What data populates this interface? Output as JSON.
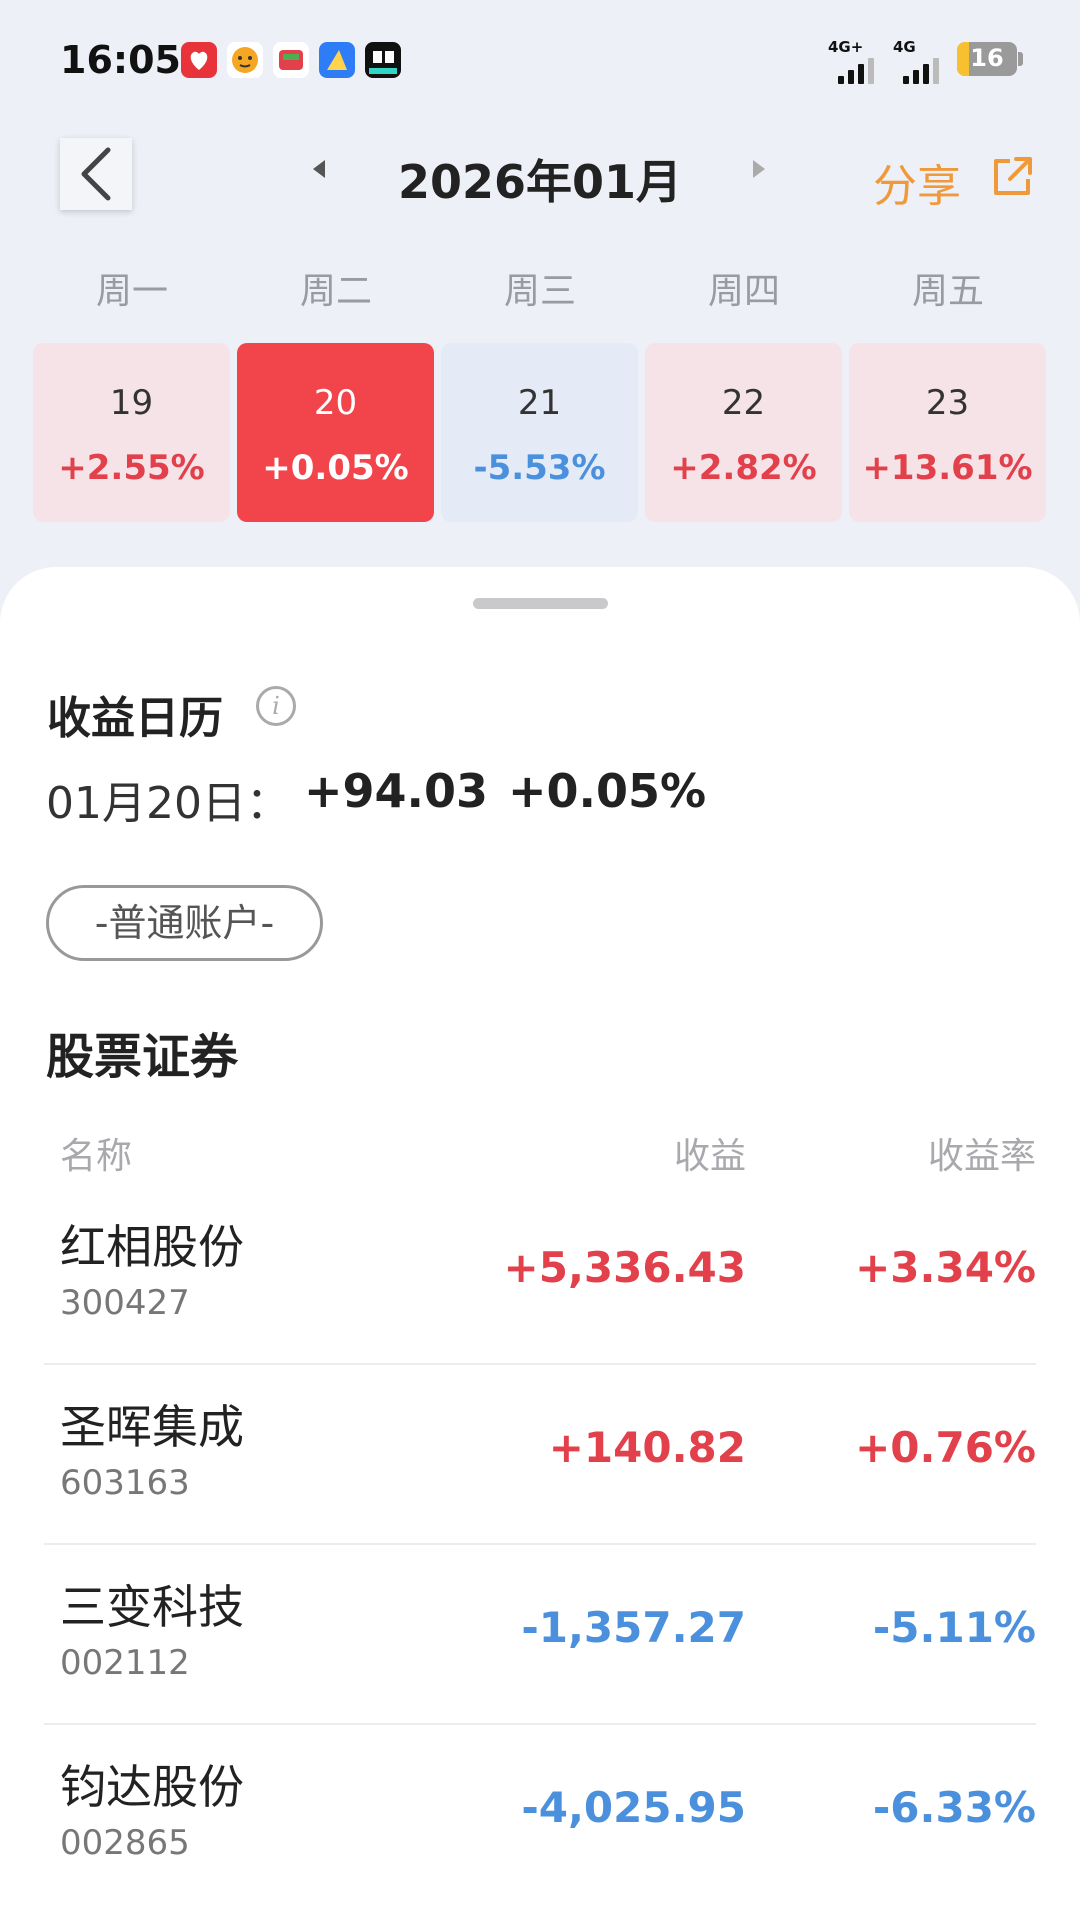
{
  "status_bar": {
    "time": "16:05",
    "network1": "4G+",
    "network2": "4G",
    "battery": "16",
    "app_icons": [
      "pinduoduo-icon",
      "tiger-app-icon",
      "jd-app-icon",
      "blue-app-icon",
      "dewu-app-icon"
    ]
  },
  "header": {
    "month": "2026年01月",
    "share_label": "分享"
  },
  "week": {
    "weekdays": [
      "周一",
      "周二",
      "周三",
      "周四",
      "周五"
    ],
    "days": [
      {
        "day": "19",
        "pct": "+2.55%",
        "state": "up"
      },
      {
        "day": "20",
        "pct": "+0.05%",
        "state": "selected"
      },
      {
        "day": "21",
        "pct": "-5.53%",
        "state": "down"
      },
      {
        "day": "22",
        "pct": "+2.82%",
        "state": "up"
      },
      {
        "day": "23",
        "pct": "+13.61%",
        "state": "up"
      }
    ]
  },
  "summary": {
    "title": "收益日历",
    "date_label": "01月20日：",
    "amount": "+94.03",
    "pct": "+0.05%"
  },
  "account": {
    "label": "-普通账户-"
  },
  "stocks": {
    "title": "股票证券",
    "columns": [
      "名称",
      "收益",
      "收益率"
    ],
    "rows": [
      {
        "name": "红相股份",
        "code": "300427",
        "profit": "+5,336.43",
        "rate": "+3.34%",
        "dir": "up"
      },
      {
        "name": "圣晖集成",
        "code": "603163",
        "profit": "+140.82",
        "rate": "+0.76%",
        "dir": "up"
      },
      {
        "name": "三变科技",
        "code": "002112",
        "profit": "-1,357.27",
        "rate": "-5.11%",
        "dir": "down"
      },
      {
        "name": "钧达股份",
        "code": "002865",
        "profit": "-4,025.95",
        "rate": "-6.33%",
        "dir": "down"
      }
    ]
  },
  "colors": {
    "up": "#e2404a",
    "down": "#4a90dc",
    "selected_bg": "#f2444b",
    "accent_share": "#f0993a"
  }
}
